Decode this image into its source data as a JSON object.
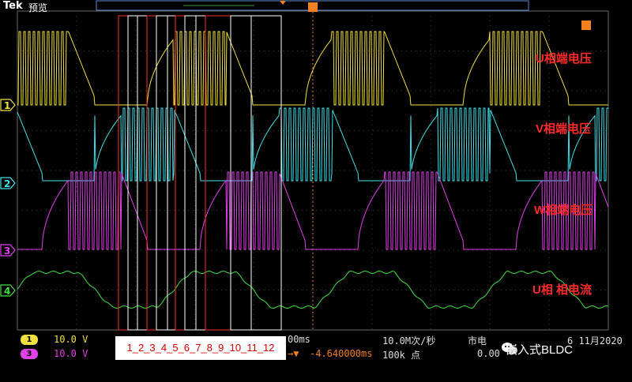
{
  "header": {
    "brand": "Tek",
    "mode": "预览"
  },
  "channels": [
    {
      "id": "1",
      "marker": "1",
      "color": "#f0e040",
      "label": "U相端电压"
    },
    {
      "id": "2",
      "marker": "2",
      "color": "#40e0e8",
      "label": "V相端电压"
    },
    {
      "id": "3",
      "marker": "3",
      "color": "#e040e8",
      "label": "W相端电压"
    },
    {
      "id": "4",
      "marker": "4",
      "color": "#40e040",
      "label": "U相 相电流"
    }
  ],
  "annotations": {
    "segments": "1_2_3_4_5_6_7_8_9_10_11_12",
    "segment_count": 12
  },
  "readouts": {
    "ch1_scale": "10.0 V",
    "ch3_scale": "10.0 V",
    "timebase_suffix": "00ms",
    "sample_rate": "10.0M次/秒",
    "record_length": "100k 点",
    "trigger_delay": "-4.640000ms",
    "trigger_source": "市电",
    "trigger_level": "0.00",
    "date": "6 11月2020",
    "ch1_badge": "1",
    "ch3_badge": "3"
  },
  "watermark": "嵌入式BLDC",
  "colors": {
    "grid": "#3a3a3a",
    "segment_box": "#ff3030",
    "segment_box_alt": "#ffffff",
    "label": "#ff2a2a"
  }
}
